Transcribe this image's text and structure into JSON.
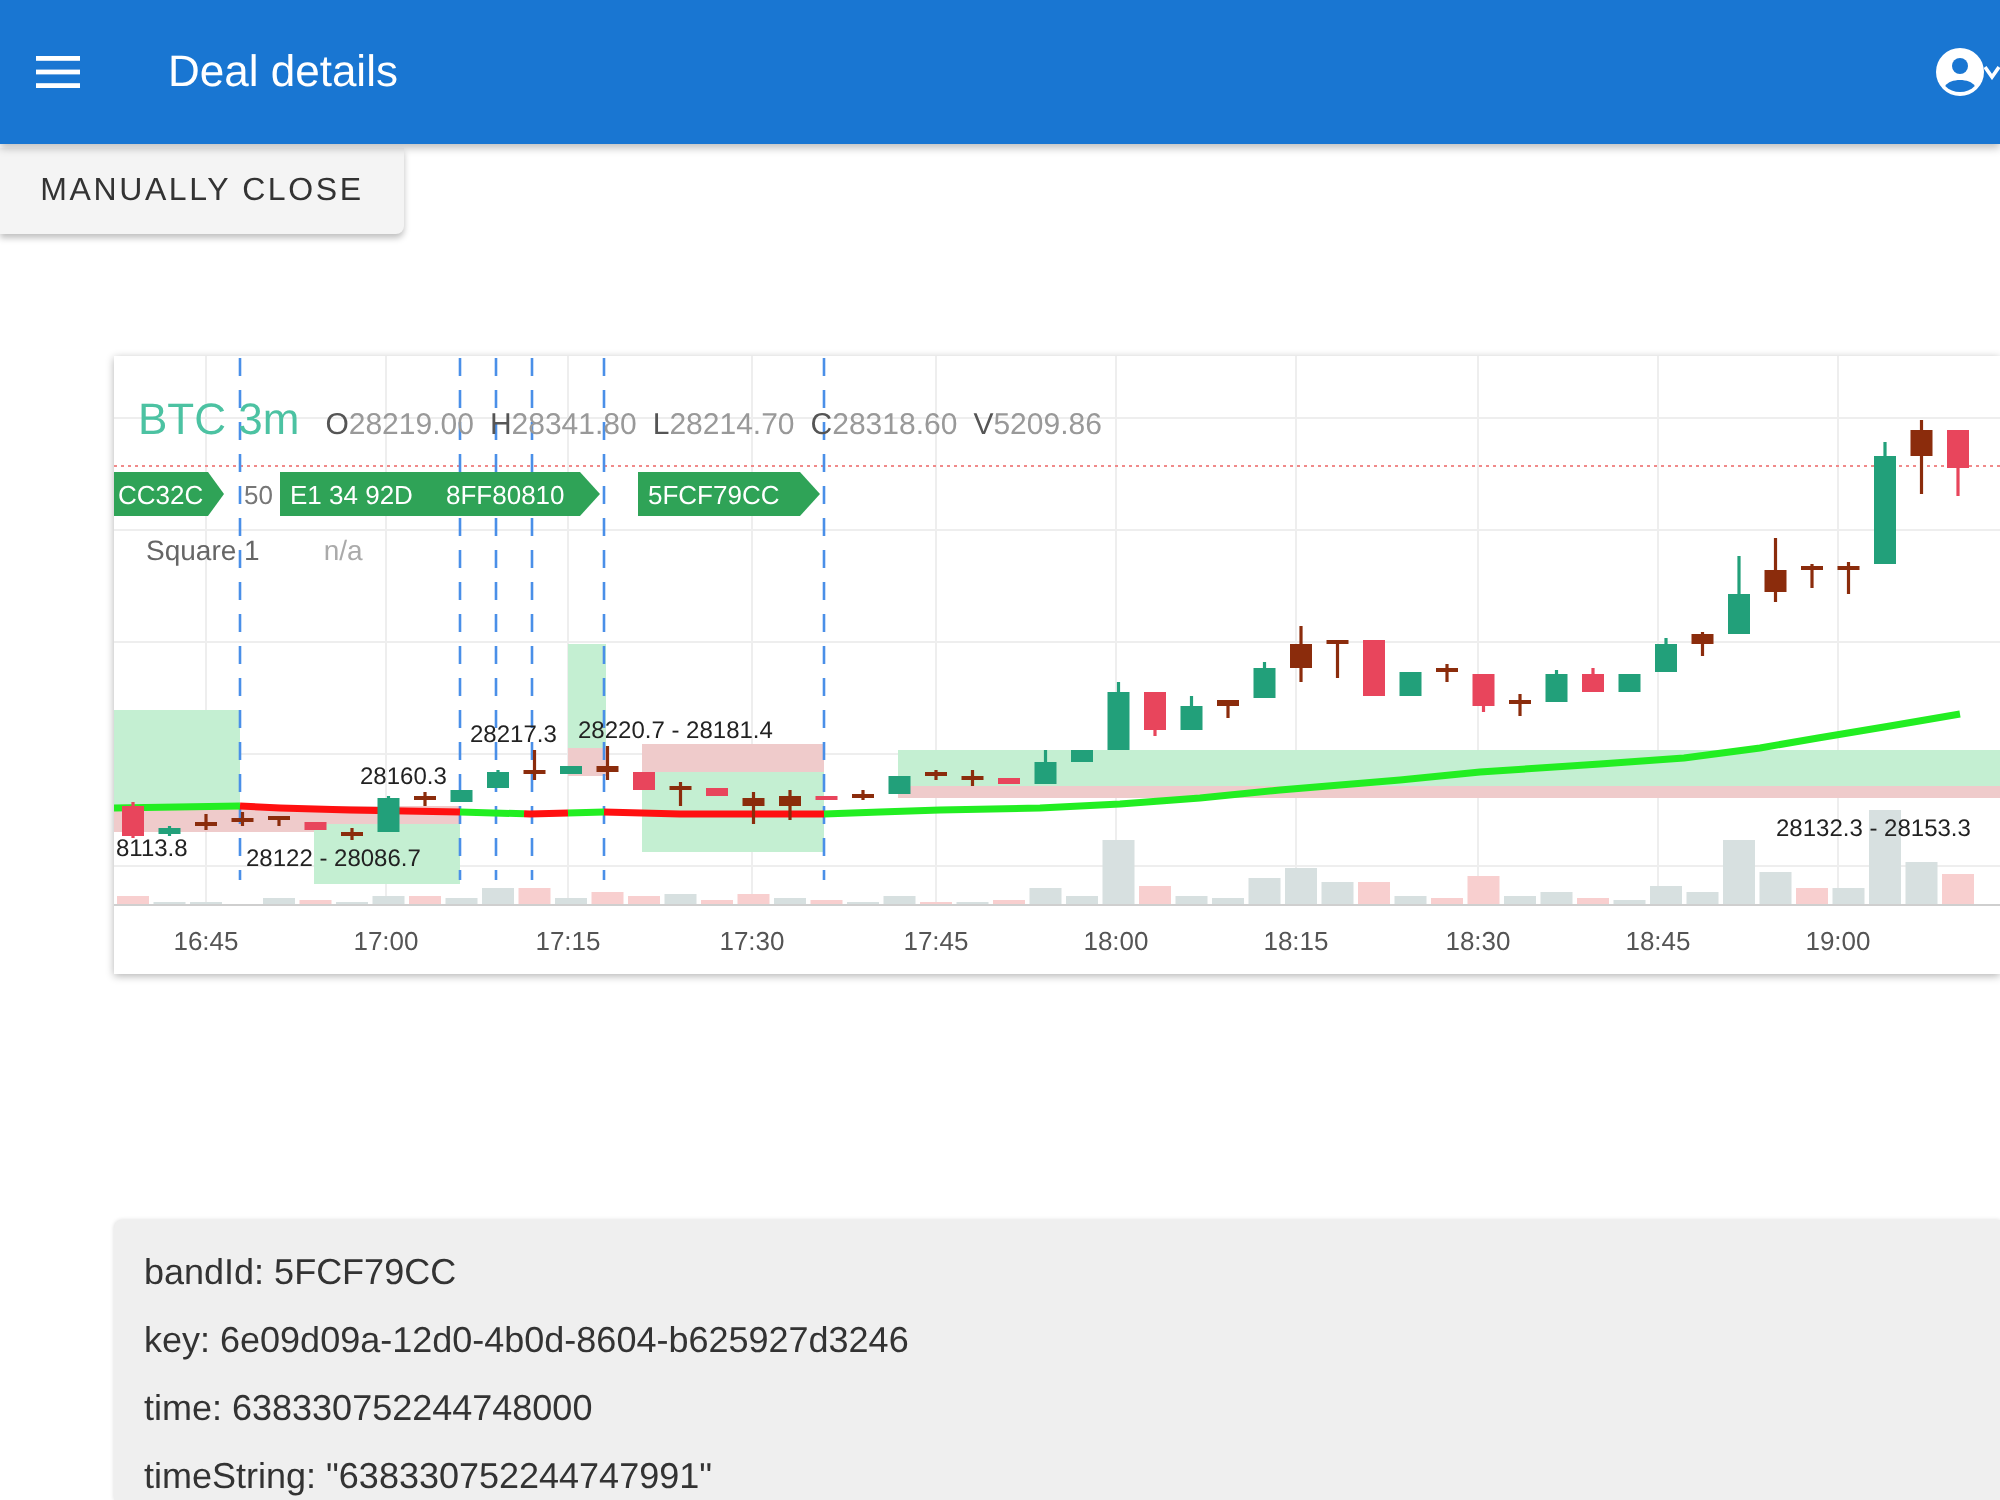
{
  "app_bar": {
    "title": "Deal details"
  },
  "toolbar": {
    "buttons": [
      {
        "label": "MANUALLY CLOSE"
      }
    ]
  },
  "chart": {
    "symbol": "BTC 3m",
    "ohlcv": [
      {
        "letter": "O",
        "value": "28219.00"
      },
      {
        "letter": "H",
        "value": "28341.80"
      },
      {
        "letter": "L",
        "value": "28214.70"
      },
      {
        "letter": "C",
        "value": "28318.60"
      },
      {
        "letter": "V",
        "value": "5209.86"
      }
    ],
    "legend_value": "50",
    "study": {
      "name": "Square 1",
      "value": "n/a"
    },
    "markers": [
      {
        "label": "CC32C"
      },
      {
        "label": "E1 34 92D"
      },
      {
        "label": "8FF80810"
      },
      {
        "label": "5FCF79CC"
      }
    ],
    "range_labels": [
      "8113.8",
      "28122 - 28086.7",
      "28160.3",
      "28217.3",
      "28220.7 - 28181.4",
      "28132.3 - 28153.3"
    ],
    "time_ticks": [
      "16:45",
      "17:00",
      "17:15",
      "17:30",
      "17:45",
      "18:00",
      "18:15",
      "18:30",
      "18:45",
      "19:00"
    ]
  },
  "details": {
    "lines": [
      "bandId: 5FCF79CC",
      "key: 6e09d09a-12d0-4b0d-8604-b625927d3246",
      "time: 638330752244748000",
      "timeString: \"638330752244747991\""
    ]
  }
}
